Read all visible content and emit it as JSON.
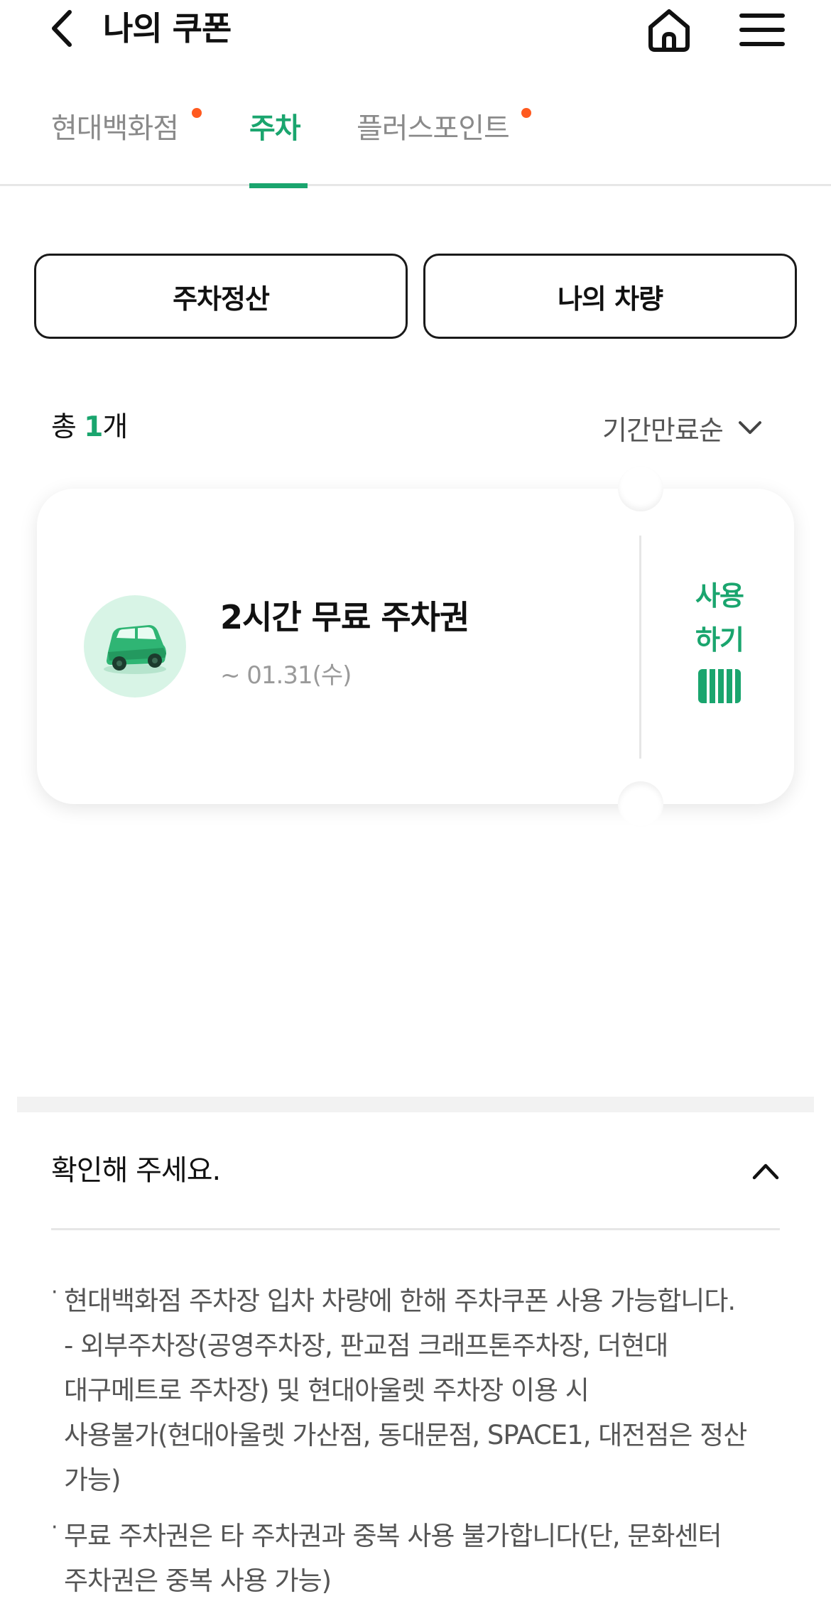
{
  "header": {
    "title": "나의 쿠폰",
    "back_icon": "chevron-left-icon",
    "home_icon": "home-icon",
    "menu_icon": "hamburger-menu-icon"
  },
  "tabs": [
    {
      "label": "현대백화점",
      "active": false,
      "has_dot": true
    },
    {
      "label": "주차",
      "active": true,
      "has_dot": false
    },
    {
      "label": "플러스포인트",
      "active": false,
      "has_dot": true
    }
  ],
  "actions": {
    "parking_payment": "주차정산",
    "my_vehicle": "나의 차량"
  },
  "list": {
    "count_prefix": "총 ",
    "count": "1",
    "count_suffix": "개",
    "sort_label": "기간만료순"
  },
  "coupon": {
    "title": "2시간 무료 주차권",
    "expiry": "~ 01.31(수)",
    "use_line1": "사용",
    "use_line2": "하기",
    "icon": "car-icon"
  },
  "notice": {
    "title": "확인해 주세요.",
    "items": [
      "현대백화점 주차장 입차 차량에 한해 주차쿠폰 사용 가능합니다.\n- 외부주차장(공영주차장, 판교점 크래프톤주차장, 더현대\n대구메트로 주차장) 및 현대아울렛 주차장 이용 시\n사용불가(현대아울렛 가산점, 동대문점, SPACE1, 대전점은 정산\n가능)",
      "무료 주차권은 타 주차권과 중복 사용 불가합니다(단, 문화센터\n주차권은 중복 사용 가능)"
    ]
  },
  "colors": {
    "accent": "#1aa56e",
    "dot": "#ff5a1f",
    "car_bg": "#d8f4e6"
  }
}
